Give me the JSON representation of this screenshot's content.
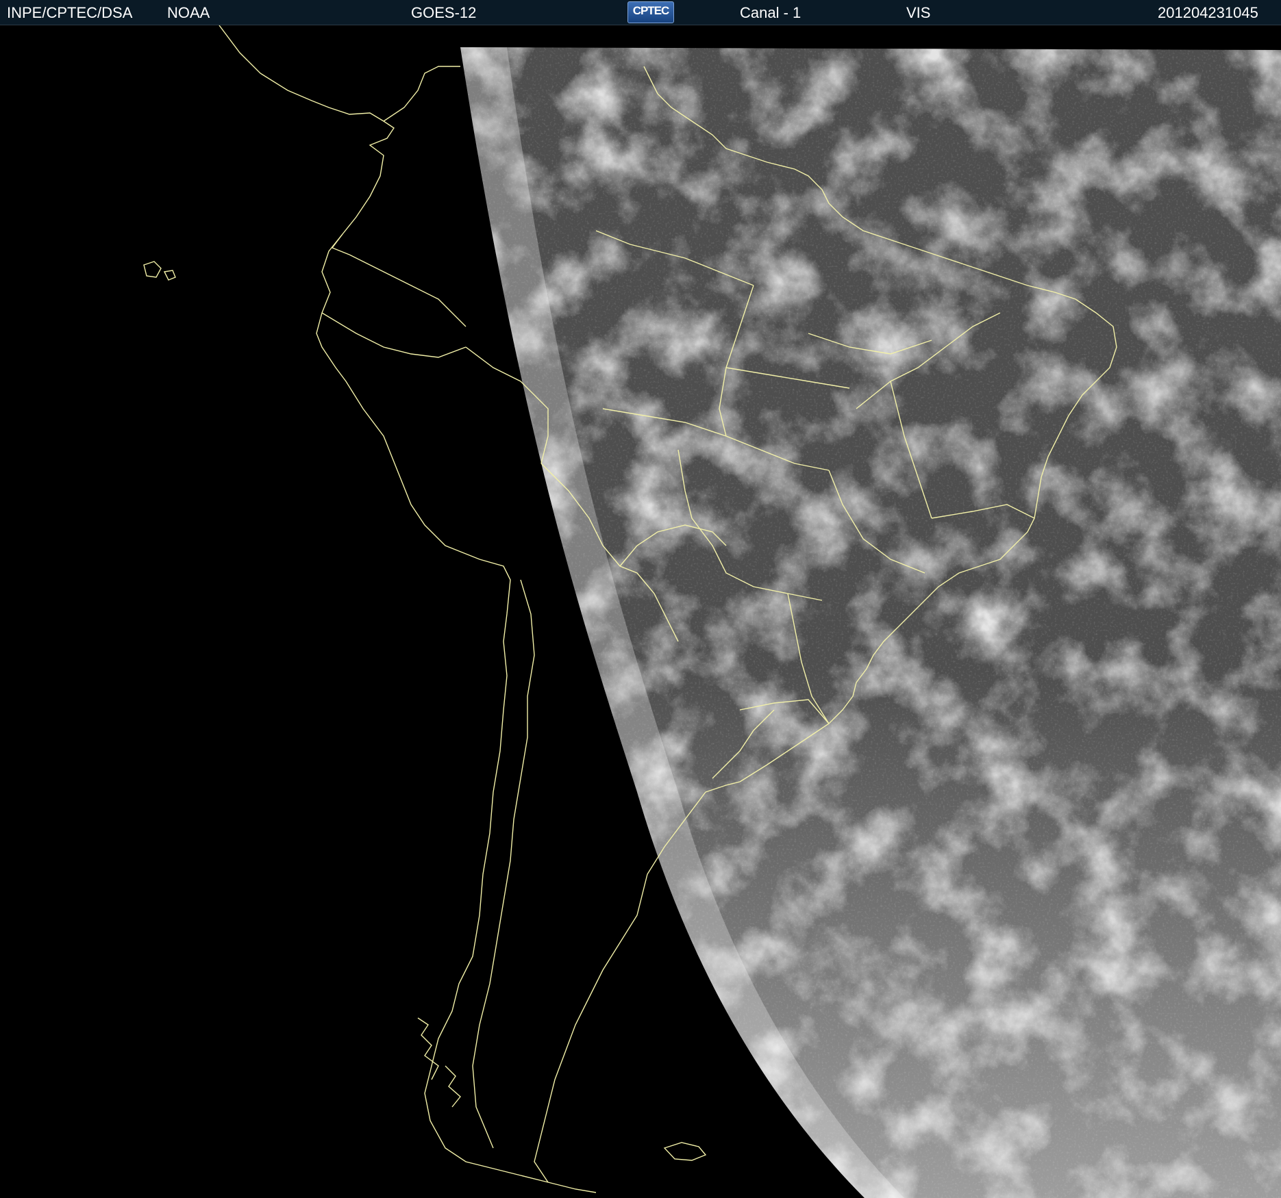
{
  "header": {
    "source": "INPE/CPTEC/DSA",
    "agency": "NOAA",
    "satellite": "GOES-12",
    "logo_text": "CPTEC",
    "channel": "Canal - 1",
    "band": "VIS",
    "timestamp": "201204231045"
  },
  "colors": {
    "header_bg": "#0a1a26",
    "coastline": "#f2f0a8",
    "background": "#000000",
    "cloud_gray": "#5a5a5a"
  },
  "icons": {
    "logo": "cptec-logo-icon"
  }
}
